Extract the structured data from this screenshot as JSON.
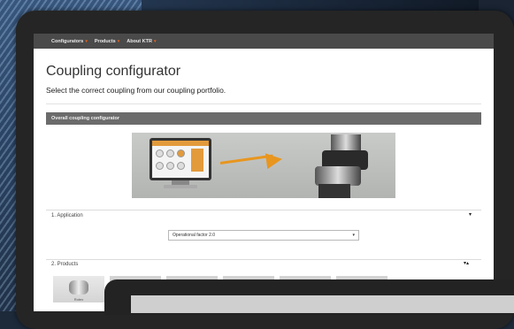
{
  "navbar": {
    "items": [
      {
        "label": "Configurators"
      },
      {
        "label": "Products"
      },
      {
        "label": "About KTR"
      }
    ]
  },
  "page": {
    "title": "Coupling configurator",
    "subtitle": "Select the correct coupling from our coupling portfolio."
  },
  "section": {
    "header": "Overall coupling configurator"
  },
  "steps": {
    "application": {
      "label": "1. Application",
      "select_value": "Operational factor 2.0"
    },
    "products": {
      "label": "2. Products",
      "first_thumb_caption": "Rotex"
    }
  },
  "colors": {
    "accent": "#e8961e",
    "navbar": "#4a4a4a",
    "section_header": "#6b6b6b"
  }
}
